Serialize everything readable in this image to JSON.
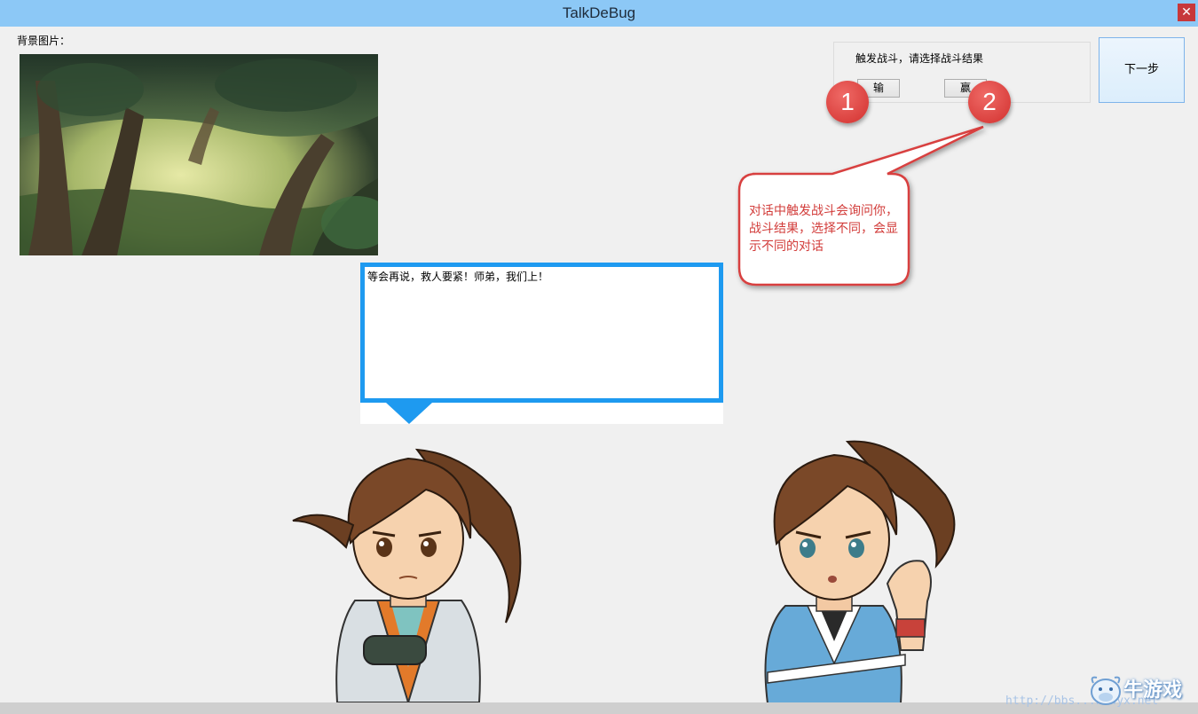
{
  "window": {
    "title": "TalkDeBug",
    "close_glyph": "✕"
  },
  "background": {
    "label": "背景图片：",
    "image_icon": "forest-scene"
  },
  "battle": {
    "prompt": "触发战斗，请选择战斗结果",
    "lose_label": "输",
    "win_label": "赢"
  },
  "next_button": {
    "label": "下一步"
  },
  "annotations": {
    "badge_1": "1",
    "badge_2": "2",
    "callout": "对话中触发战斗会询问你，战斗结果，选择不同，会显示不同的对话",
    "accent_color": "#d8413f"
  },
  "dialog": {
    "text": "等会再说，救人要紧！师弟，我们上！",
    "border_color": "#1e9af0"
  },
  "characters": [
    {
      "name_icon": "swordsman-character-icon"
    },
    {
      "name_icon": "young-fighter-character-icon"
    }
  ],
  "watermark": {
    "url": "http://bbs...newyx.net",
    "logo_text": "牛游戏"
  }
}
